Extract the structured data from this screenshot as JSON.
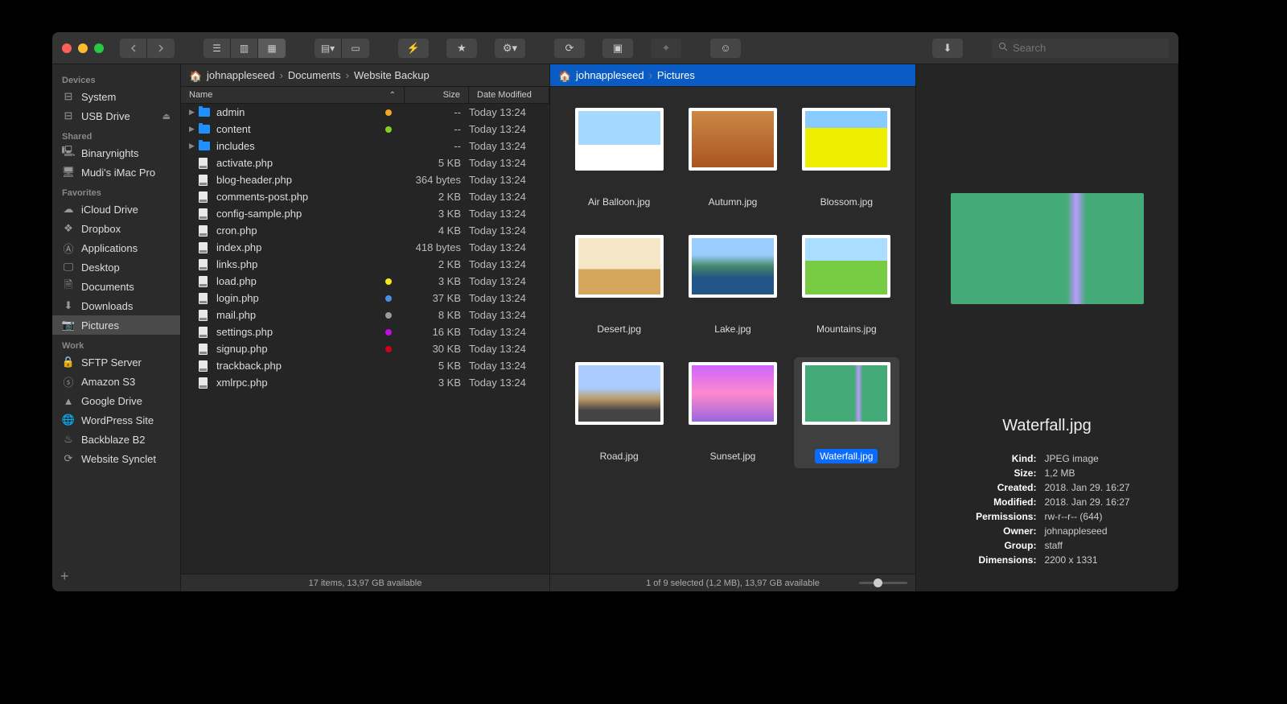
{
  "search": {
    "placeholder": "Search"
  },
  "sidebar": {
    "sections": [
      {
        "header": "Devices",
        "items": [
          {
            "icon": "disk",
            "label": "System"
          },
          {
            "icon": "disk",
            "label": "USB Drive",
            "eject": true
          }
        ]
      },
      {
        "header": "Shared",
        "items": [
          {
            "icon": "server",
            "label": "Binarynights"
          },
          {
            "icon": "imac",
            "label": "Mudi's iMac Pro"
          }
        ]
      },
      {
        "header": "Favorites",
        "items": [
          {
            "icon": "cloud",
            "label": "iCloud Drive"
          },
          {
            "icon": "dropbox",
            "label": "Dropbox"
          },
          {
            "icon": "apps",
            "label": "Applications"
          },
          {
            "icon": "desktop",
            "label": "Desktop"
          },
          {
            "icon": "docs",
            "label": "Documents"
          },
          {
            "icon": "download",
            "label": "Downloads"
          },
          {
            "icon": "pictures",
            "label": "Pictures",
            "selected": true
          }
        ]
      },
      {
        "header": "Work",
        "items": [
          {
            "icon": "lock",
            "label": "SFTP Server"
          },
          {
            "icon": "s3",
            "label": "Amazon S3"
          },
          {
            "icon": "gdrive",
            "label": "Google Drive"
          },
          {
            "icon": "globe",
            "label": "WordPress Site"
          },
          {
            "icon": "flame",
            "label": "Backblaze B2"
          },
          {
            "icon": "sync",
            "label": "Website Synclet"
          }
        ]
      }
    ]
  },
  "pane1": {
    "breadcrumb": [
      "johnappleseed",
      "Documents",
      "Website Backup"
    ],
    "columns": {
      "name": "Name",
      "size": "Size",
      "date": "Date Modified"
    },
    "files": [
      {
        "type": "folder",
        "name": "admin",
        "tag": "orange",
        "size": "--",
        "date": "Today 13:24",
        "expandable": true
      },
      {
        "type": "folder",
        "name": "content",
        "tag": "green",
        "size": "--",
        "date": "Today 13:24",
        "expandable": true
      },
      {
        "type": "folder",
        "name": "includes",
        "tag": "",
        "size": "--",
        "date": "Today 13:24",
        "expandable": true
      },
      {
        "type": "file",
        "name": "activate.php",
        "tag": "",
        "size": "5 KB",
        "date": "Today 13:24"
      },
      {
        "type": "file",
        "name": "blog-header.php",
        "tag": "",
        "size": "364 bytes",
        "date": "Today 13:24"
      },
      {
        "type": "file",
        "name": "comments-post.php",
        "tag": "",
        "size": "2 KB",
        "date": "Today 13:24"
      },
      {
        "type": "file",
        "name": "config-sample.php",
        "tag": "",
        "size": "3 KB",
        "date": "Today 13:24"
      },
      {
        "type": "file",
        "name": "cron.php",
        "tag": "",
        "size": "4 KB",
        "date": "Today 13:24"
      },
      {
        "type": "file",
        "name": "index.php",
        "tag": "",
        "size": "418 bytes",
        "date": "Today 13:24"
      },
      {
        "type": "file",
        "name": "links.php",
        "tag": "",
        "size": "2 KB",
        "date": "Today 13:24"
      },
      {
        "type": "file",
        "name": "load.php",
        "tag": "yellow",
        "size": "3 KB",
        "date": "Today 13:24"
      },
      {
        "type": "file",
        "name": "login.php",
        "tag": "blue",
        "size": "37 KB",
        "date": "Today 13:24"
      },
      {
        "type": "file",
        "name": "mail.php",
        "tag": "gray",
        "size": "8 KB",
        "date": "Today 13:24"
      },
      {
        "type": "file",
        "name": "settings.php",
        "tag": "purple",
        "size": "16 KB",
        "date": "Today 13:24"
      },
      {
        "type": "file",
        "name": "signup.php",
        "tag": "red",
        "size": "30 KB",
        "date": "Today 13:24"
      },
      {
        "type": "file",
        "name": "trackback.php",
        "tag": "",
        "size": "5 KB",
        "date": "Today 13:24"
      },
      {
        "type": "file",
        "name": "xmlrpc.php",
        "tag": "",
        "size": "3 KB",
        "date": "Today 13:24"
      }
    ],
    "status": "17 items, 13,97 GB available"
  },
  "pane2": {
    "breadcrumb": [
      "johnappleseed",
      "Pictures"
    ],
    "items": [
      {
        "name": "Air Balloon.jpg",
        "thumb": "th-balloon"
      },
      {
        "name": "Autumn.jpg",
        "thumb": "th-autumn"
      },
      {
        "name": "Blossom.jpg",
        "thumb": "th-blossom"
      },
      {
        "name": "Desert.jpg",
        "thumb": "th-desert"
      },
      {
        "name": "Lake.jpg",
        "thumb": "th-lake"
      },
      {
        "name": "Mountains.jpg",
        "thumb": "th-mountains"
      },
      {
        "name": "Road.jpg",
        "thumb": "th-road"
      },
      {
        "name": "Sunset.jpg",
        "thumb": "th-sunset"
      },
      {
        "name": "Waterfall.jpg",
        "thumb": "th-waterfall",
        "selected": true
      }
    ],
    "status": "1 of 9 selected (1,2 MB), 13,97 GB available"
  },
  "preview": {
    "title": "Waterfall.jpg",
    "thumb": "th-waterfall",
    "rows": [
      {
        "label": "Kind:",
        "value": "JPEG image"
      },
      {
        "label": "Size:",
        "value": "1,2 MB"
      },
      {
        "label": "Created:",
        "value": "2018. Jan 29. 16:27"
      },
      {
        "label": "Modified:",
        "value": "2018. Jan 29. 16:27"
      },
      {
        "label": "Permissions:",
        "value": "rw-r--r-- (644)"
      },
      {
        "label": "Owner:",
        "value": "johnappleseed"
      },
      {
        "label": "Group:",
        "value": "staff"
      },
      {
        "label": "Dimensions:",
        "value": "2200 x 1331"
      }
    ]
  }
}
